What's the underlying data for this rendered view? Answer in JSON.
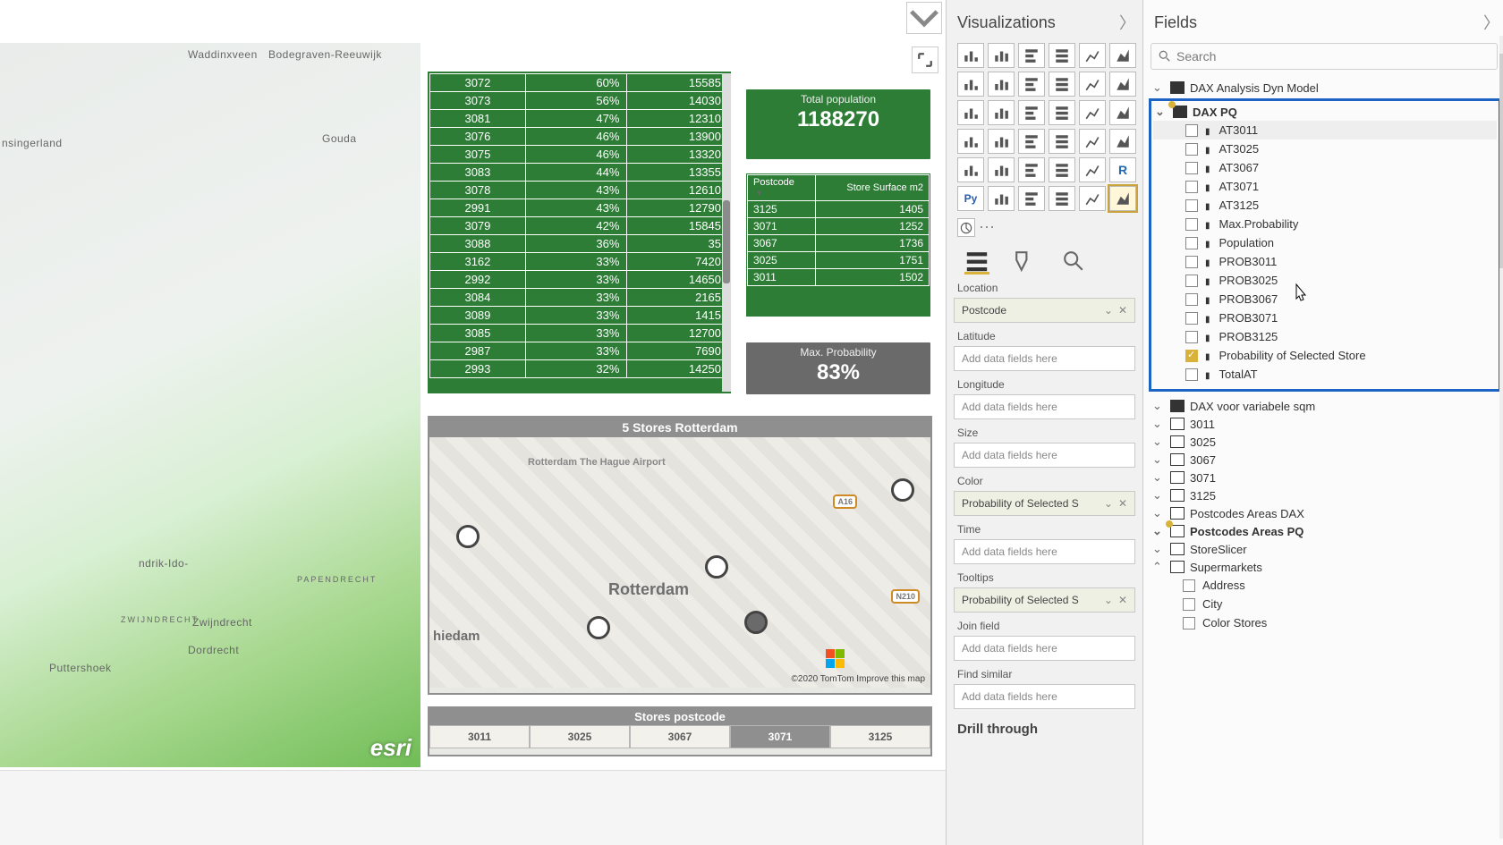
{
  "canvas": {
    "table_rows": [
      {
        "pc": "3072",
        "pct": "60%",
        "val": "15585"
      },
      {
        "pc": "3073",
        "pct": "56%",
        "val": "14030"
      },
      {
        "pc": "3081",
        "pct": "47%",
        "val": "12310"
      },
      {
        "pc": "3076",
        "pct": "46%",
        "val": "13900"
      },
      {
        "pc": "3075",
        "pct": "46%",
        "val": "13320"
      },
      {
        "pc": "3083",
        "pct": "44%",
        "val": "13355"
      },
      {
        "pc": "3078",
        "pct": "43%",
        "val": "12610"
      },
      {
        "pc": "2991",
        "pct": "43%",
        "val": "12790"
      },
      {
        "pc": "3079",
        "pct": "42%",
        "val": "15845"
      },
      {
        "pc": "3088",
        "pct": "36%",
        "val": "35"
      },
      {
        "pc": "3162",
        "pct": "33%",
        "val": "7420"
      },
      {
        "pc": "2992",
        "pct": "33%",
        "val": "14650"
      },
      {
        "pc": "3084",
        "pct": "33%",
        "val": "2165"
      },
      {
        "pc": "3089",
        "pct": "33%",
        "val": "1415"
      },
      {
        "pc": "3085",
        "pct": "33%",
        "val": "12700"
      },
      {
        "pc": "2987",
        "pct": "33%",
        "val": "7690"
      },
      {
        "pc": "2993",
        "pct": "32%",
        "val": "14250"
      }
    ],
    "choromap_labels": [
      "Waddinxveen",
      "Bodegraven-Reeuwijk",
      "nsingerland",
      "Gouda",
      "ndrik-Ido-",
      "ZWIJNDRECHT",
      "Zwijndrecht",
      "Dordrecht",
      "Puttershoek",
      "PAPENDRECHT"
    ],
    "choromap_brand": "esri",
    "kpi_pop_t": "Total population",
    "kpi_pop_v": "1188270",
    "kpi_prob_t": "Max. Probability",
    "kpi_prob_v": "83%",
    "storesurf_head": [
      "Postcode",
      "Store Surface m2"
    ],
    "storesurf_rows": [
      {
        "pc": "3125",
        "m2": "1405"
      },
      {
        "pc": "3071",
        "m2": "1252"
      },
      {
        "pc": "3067",
        "m2": "1736"
      },
      {
        "pc": "3025",
        "m2": "1751"
      },
      {
        "pc": "3011",
        "m2": "1502"
      }
    ],
    "storesmap_title": "5 Stores Rotterdam",
    "storesmap_places": {
      "rotterdam": "Rotterdam",
      "schiedam": "hiedam",
      "airport": "Rotterdam The Hague Airport"
    },
    "storesmap_badges": {
      "a16": "A16",
      "n210": "N210"
    },
    "storesmap_attr": "©2020 TomTom  Improve this map",
    "slicer_title": "Stores postcode",
    "slicer_opts": [
      "3011",
      "3025",
      "3067",
      "3071",
      "3125"
    ],
    "slicer_selected_idx": 3
  },
  "vis": {
    "title": "Visualizations",
    "wells": {
      "location_l": "Location",
      "location_v": "Postcode",
      "latitude_l": "Latitude",
      "latitude_v": "Add data fields here",
      "longitude_l": "Longitude",
      "longitude_v": "Add data fields here",
      "size_l": "Size",
      "size_v": "Add data fields here",
      "color_l": "Color",
      "color_v": "Probability of Selected S",
      "time_l": "Time",
      "time_v": "Add data fields here",
      "tooltips_l": "Tooltips",
      "tooltips_v": "Probability of Selected S",
      "join_l": "Join field",
      "join_v": "Add data fields here",
      "findsim_l": "Find similar",
      "findsim_v": "Add data fields here"
    },
    "drill": "Drill through"
  },
  "fields": {
    "title": "Fields",
    "search_ph": "Search",
    "tables": {
      "dax_model": "DAX Analysis Dyn Model",
      "dax_pq": "DAX PQ",
      "dax_var": "DAX voor variabele sqm",
      "t3011": "3011",
      "t3025": "3025",
      "t3067": "3067",
      "t3071": "3071",
      "t3125": "3125",
      "pa_dax": "Postcodes Areas DAX",
      "pa_pq": "Postcodes Areas PQ",
      "storeslicer": "StoreSlicer",
      "supermarkets": "Supermarkets"
    },
    "dax_pq_fields": [
      "AT3011",
      "AT3025",
      "AT3067",
      "AT3071",
      "AT3125",
      "Max.Probability",
      "Population",
      "PROB3011",
      "PROB3025",
      "PROB3067",
      "PROB3071",
      "PROB3125",
      "Probability of Selected Store",
      "TotalAT"
    ],
    "sup_fields": [
      "Address",
      "City",
      "Color Stores"
    ]
  }
}
